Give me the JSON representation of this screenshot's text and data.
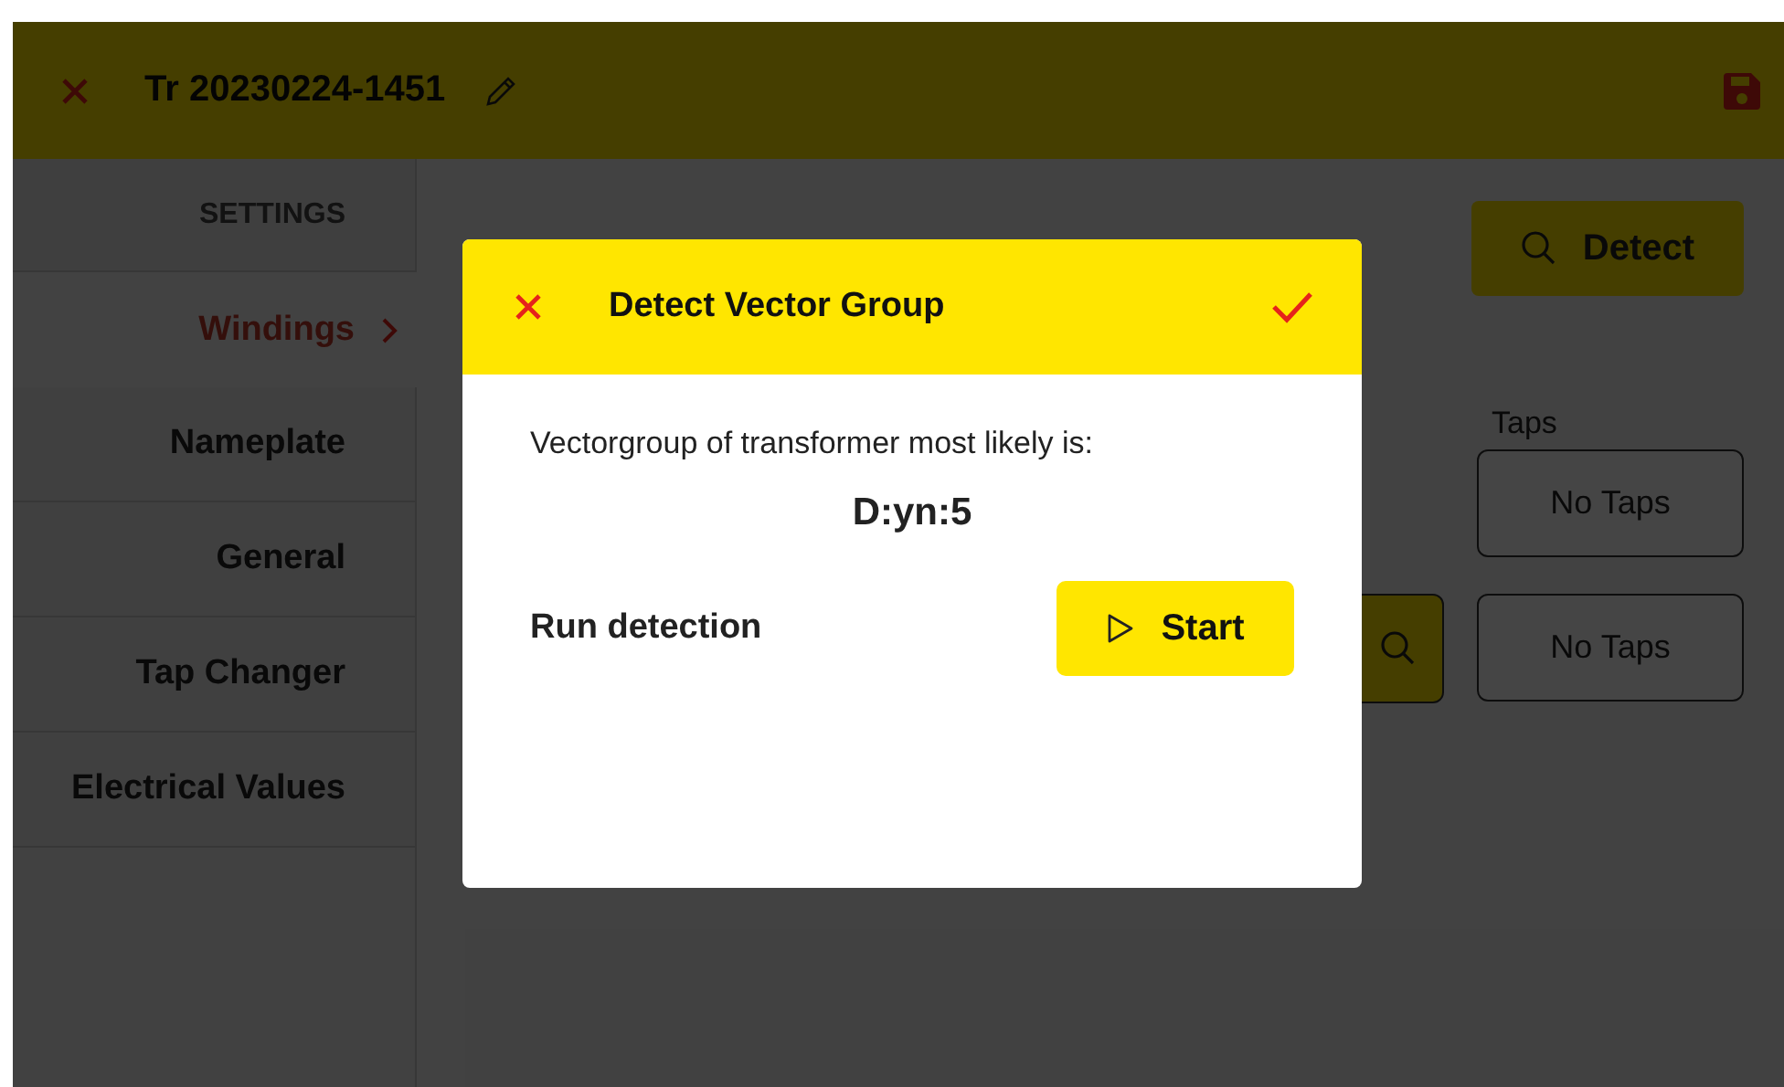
{
  "header": {
    "title": "Tr 20230224-1451"
  },
  "sidebar": {
    "heading": "SETTINGS",
    "items": [
      {
        "label": "Windings",
        "selected": true
      },
      {
        "label": "Nameplate",
        "selected": false
      },
      {
        "label": "General",
        "selected": false
      },
      {
        "label": "Tap Changer",
        "selected": false
      },
      {
        "label": "Electrical Values",
        "selected": false
      }
    ]
  },
  "content": {
    "detect_button": "Detect",
    "taps_label": "Taps",
    "tap_fields": [
      {
        "value": "No Taps"
      },
      {
        "value": "No Taps"
      }
    ]
  },
  "dialog": {
    "title": "Detect Vector Group",
    "message": "Vectorgroup of transformer most likely is:",
    "result": "D:yn:5",
    "action_label": "Run detection",
    "start_button": "Start"
  }
}
